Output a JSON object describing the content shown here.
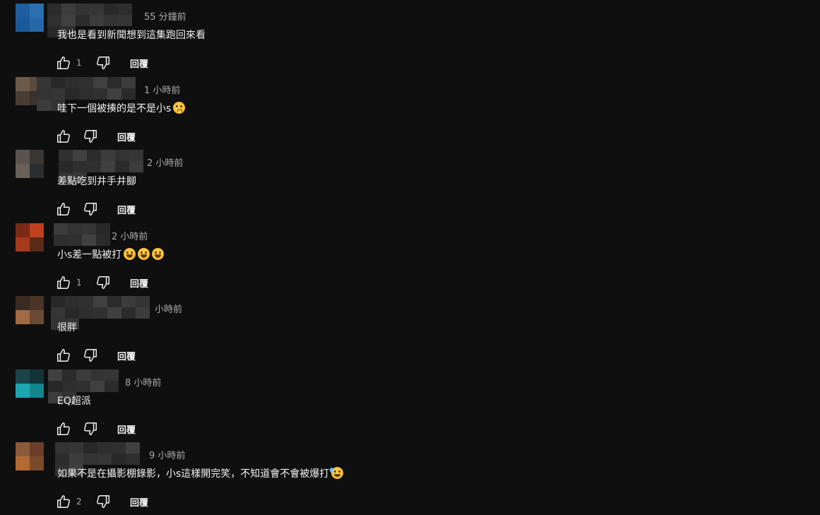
{
  "colors": {
    "background": "#0f0f0f",
    "text": "#f1f1f1",
    "secondary_text": "#aaaaaa"
  },
  "reply_label": "回覆",
  "icons": {
    "like": "thumbs-up-icon",
    "dislike": "thumbs-down-icon"
  },
  "comments": [
    {
      "time": "55 分鐘前",
      "text": "我也是看到新聞想到這集跑回來看",
      "emoji": [],
      "likes": "1",
      "avatar_colors": [
        "#1f5f9e",
        "#2a6fb0",
        "#1b5a98",
        "#2468a8"
      ]
    },
    {
      "time": "1 小時前",
      "text": "哇下一個被揍的是不是小s",
      "emoji": [
        "worried-face"
      ],
      "likes": "",
      "avatar_colors": [
        "#6e5a4a",
        "#5a4a3e",
        "#4a3e34",
        "#3a322c"
      ]
    },
    {
      "time": "2 小時前",
      "text": "差點吃到井手井腳",
      "emoji": [],
      "likes": "",
      "avatar_colors": [
        "#5a5450",
        "#3a3634",
        "#6a6058",
        "#2a2e30"
      ]
    },
    {
      "time": "2 小時前",
      "text": "小s差一點被打",
      "emoji": [
        "laughing-face",
        "laughing-face",
        "laughing-face"
      ],
      "likes": "1",
      "avatar_colors": [
        "#7a2a18",
        "#c0401e",
        "#a8391c",
        "#5a2a1a"
      ]
    },
    {
      "time": "小時前",
      "text": "很胖",
      "emoji": [],
      "likes": "",
      "avatar_colors": [
        "#3a2a22",
        "#4a3428",
        "#a06a44",
        "#6a4a32"
      ]
    },
    {
      "time": "8 小時前",
      "text": "EQ超派",
      "emoji": [],
      "likes": "",
      "avatar_colors": [
        "#1a4448",
        "#123438",
        "#1ea6b0",
        "#13868e"
      ]
    },
    {
      "time": "9 小時前",
      "text": "如果不是在攝影棚錄影，小s這樣開完笑，不知道會不會被爆打",
      "emoji": [
        "sweat-smile-face"
      ],
      "likes": "2",
      "avatar_colors": [
        "#8a5a3a",
        "#6a3e2a",
        "#b06a32",
        "#7a4a2a"
      ]
    }
  ]
}
